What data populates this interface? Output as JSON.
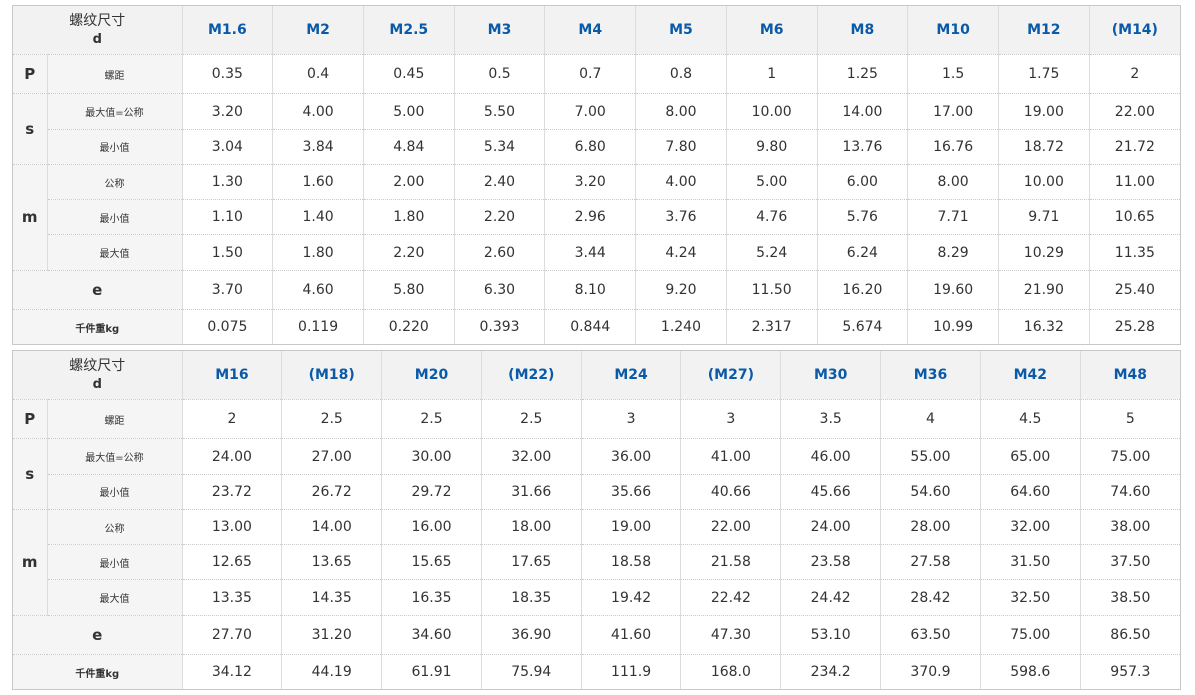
{
  "labels": {
    "spec_title": "螺纹尺寸",
    "spec_sub": "d",
    "p_group": "P",
    "p_pitch": "螺距",
    "s_group": "s",
    "s_max": "最大值=公称",
    "s_min": "最小值",
    "m_group": "m",
    "m_nominal": "公称",
    "m_min": "最小值",
    "m_max": "最大值",
    "e_label": "e",
    "weight_label": "千件重kg"
  },
  "tables": [
    {
      "sizes": [
        "M1.6",
        "M2",
        "M2.5",
        "M3",
        "M4",
        "M5",
        "M6",
        "M8",
        "M10",
        "M12",
        "(M14)"
      ],
      "rows": {
        "p": [
          "0.35",
          "0.4",
          "0.45",
          "0.5",
          "0.7",
          "0.8",
          "1",
          "1.25",
          "1.5",
          "1.75",
          "2"
        ],
        "s_max": [
          "3.20",
          "4.00",
          "5.00",
          "5.50",
          "7.00",
          "8.00",
          "10.00",
          "14.00",
          "17.00",
          "19.00",
          "22.00"
        ],
        "s_min": [
          "3.04",
          "3.84",
          "4.84",
          "5.34",
          "6.80",
          "7.80",
          "9.80",
          "13.76",
          "16.76",
          "18.72",
          "21.72"
        ],
        "m_nom": [
          "1.30",
          "1.60",
          "2.00",
          "2.40",
          "3.20",
          "4.00",
          "5.00",
          "6.00",
          "8.00",
          "10.00",
          "11.00"
        ],
        "m_min": [
          "1.10",
          "1.40",
          "1.80",
          "2.20",
          "2.96",
          "3.76",
          "4.76",
          "5.76",
          "7.71",
          "9.71",
          "10.65"
        ],
        "m_max": [
          "1.50",
          "1.80",
          "2.20",
          "2.60",
          "3.44",
          "4.24",
          "5.24",
          "6.24",
          "8.29",
          "10.29",
          "11.35"
        ],
        "e": [
          "3.70",
          "4.60",
          "5.80",
          "6.30",
          "8.10",
          "9.20",
          "11.50",
          "16.20",
          "19.60",
          "21.90",
          "25.40"
        ],
        "weight": [
          "0.075",
          "0.119",
          "0.220",
          "0.393",
          "0.844",
          "1.240",
          "2.317",
          "5.674",
          "10.99",
          "16.32",
          "25.28"
        ]
      }
    },
    {
      "sizes": [
        "M16",
        "(M18)",
        "M20",
        "(M22)",
        "M24",
        "(M27)",
        "M30",
        "M36",
        "M42",
        "M48"
      ],
      "rows": {
        "p": [
          "2",
          "2.5",
          "2.5",
          "2.5",
          "3",
          "3",
          "3.5",
          "4",
          "4.5",
          "5"
        ],
        "s_max": [
          "24.00",
          "27.00",
          "30.00",
          "32.00",
          "36.00",
          "41.00",
          "46.00",
          "55.00",
          "65.00",
          "75.00"
        ],
        "s_min": [
          "23.72",
          "26.72",
          "29.72",
          "31.66",
          "35.66",
          "40.66",
          "45.66",
          "54.60",
          "64.60",
          "74.60"
        ],
        "m_nom": [
          "13.00",
          "14.00",
          "16.00",
          "18.00",
          "19.00",
          "22.00",
          "24.00",
          "28.00",
          "32.00",
          "38.00"
        ],
        "m_min": [
          "12.65",
          "13.65",
          "15.65",
          "17.65",
          "18.58",
          "21.58",
          "23.58",
          "27.58",
          "31.50",
          "37.50"
        ],
        "m_max": [
          "13.35",
          "14.35",
          "16.35",
          "18.35",
          "19.42",
          "22.42",
          "24.42",
          "28.42",
          "32.50",
          "38.50"
        ],
        "e": [
          "27.70",
          "31.20",
          "34.60",
          "36.90",
          "41.60",
          "47.30",
          "53.10",
          "63.50",
          "75.00",
          "86.50"
        ],
        "weight": [
          "34.12",
          "44.19",
          "61.91",
          "75.94",
          "111.9",
          "168.0",
          "234.2",
          "370.9",
          "598.6",
          "957.3"
        ]
      }
    }
  ]
}
